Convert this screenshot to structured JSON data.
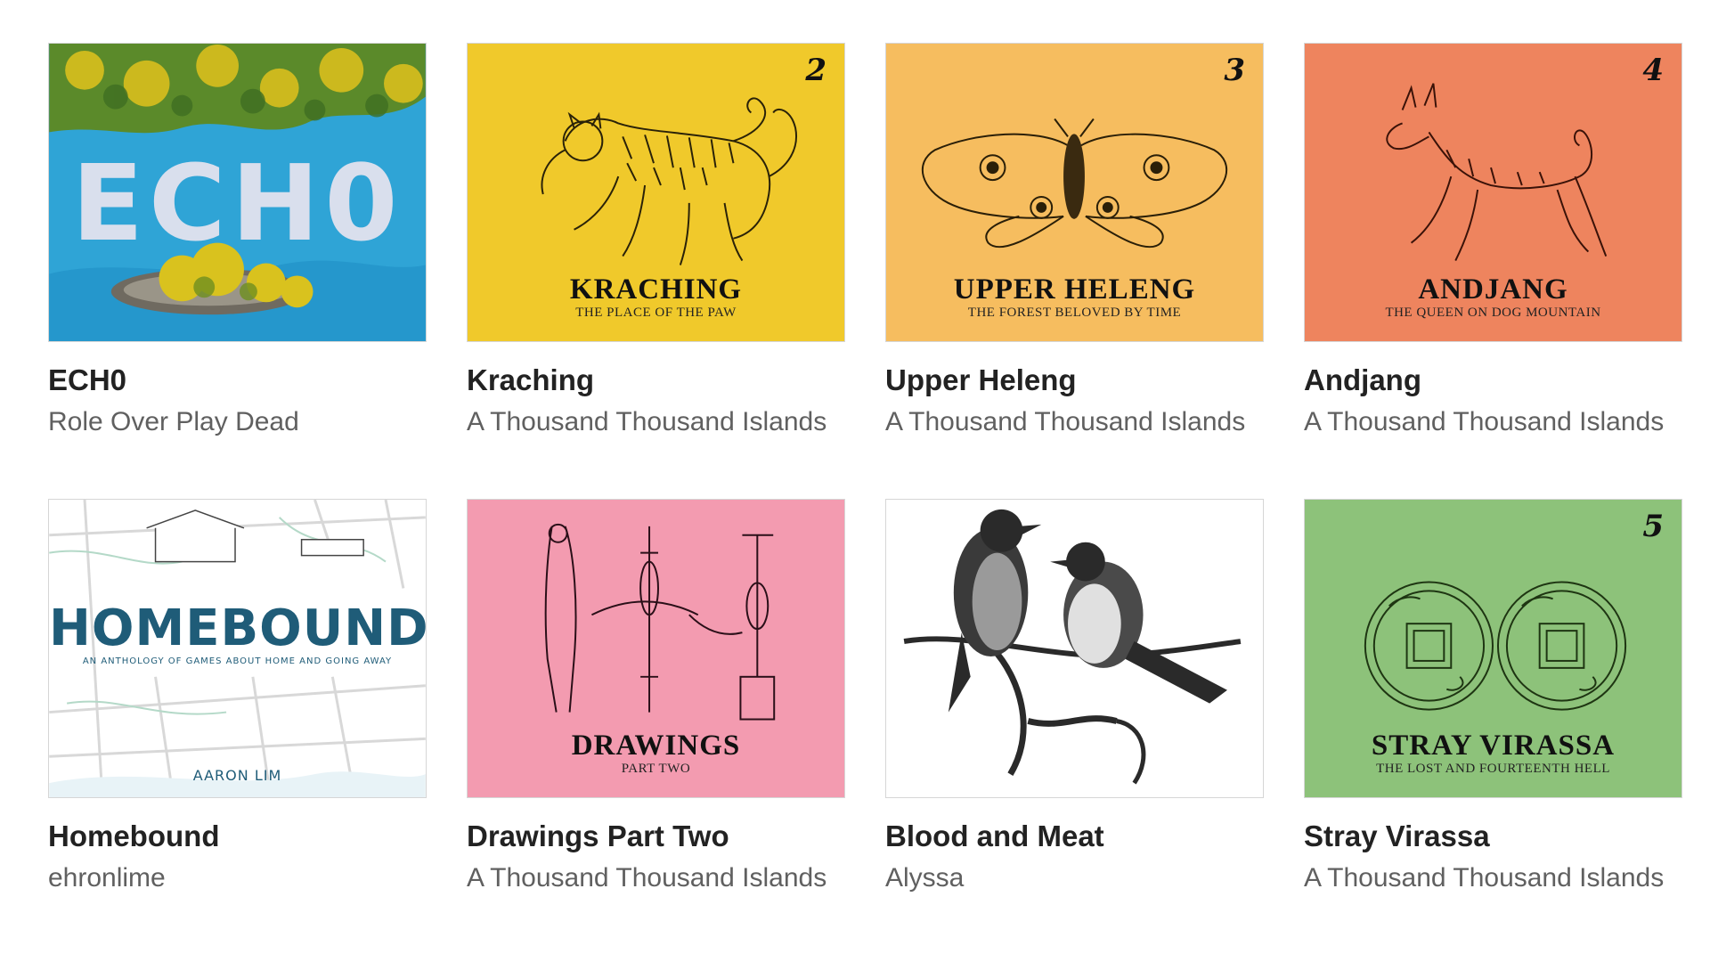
{
  "games": [
    {
      "title": "ECH0",
      "author": "Role Over Play Dead",
      "cover_text": "ECH0",
      "cover_bg": "#2fa4d6"
    },
    {
      "title": "Kraching",
      "author": "A Thousand Thousand Islands",
      "cover_number": "2",
      "cover_title": "KRACHING",
      "cover_subtitle": "THE PLACE OF THE PAW",
      "cover_bg": "#f0c92b"
    },
    {
      "title": "Upper Heleng",
      "author": "A Thousand Thousand Islands",
      "cover_number": "3",
      "cover_title": "UPPER HELENG",
      "cover_subtitle": "THE FOREST BELOVED BY TIME",
      "cover_bg": "#f6bd5f"
    },
    {
      "title": "Andjang",
      "author": "A Thousand Thousand Islands",
      "cover_number": "4",
      "cover_title": "ANDJANG",
      "cover_subtitle": "THE QUEEN ON DOG MOUNTAIN",
      "cover_bg": "#ee845e"
    },
    {
      "title": "Homebound",
      "author": "ehronlime",
      "cover_title": "HOMEBOUND",
      "cover_subtitle": "AN ANTHOLOGY OF GAMES ABOUT HOME AND GOING AWAY",
      "cover_author": "AARON LIM",
      "cover_bg": "#ffffff"
    },
    {
      "title": "Drawings Part Two",
      "author": "A Thousand Thousand Islands",
      "cover_title": "DRAWINGS",
      "cover_subtitle": "PART TWO",
      "cover_bg": "#f39bb0"
    },
    {
      "title": "Blood and Meat",
      "author": "Alyssa",
      "cover_bg": "#ffffff"
    },
    {
      "title": "Stray Virassa",
      "author": "A Thousand Thousand Islands",
      "cover_number": "5",
      "cover_title": "STRAY VIRASSA",
      "cover_subtitle": "THE LOST AND FOURTEENTH HELL",
      "cover_bg": "#8dc27a"
    }
  ]
}
